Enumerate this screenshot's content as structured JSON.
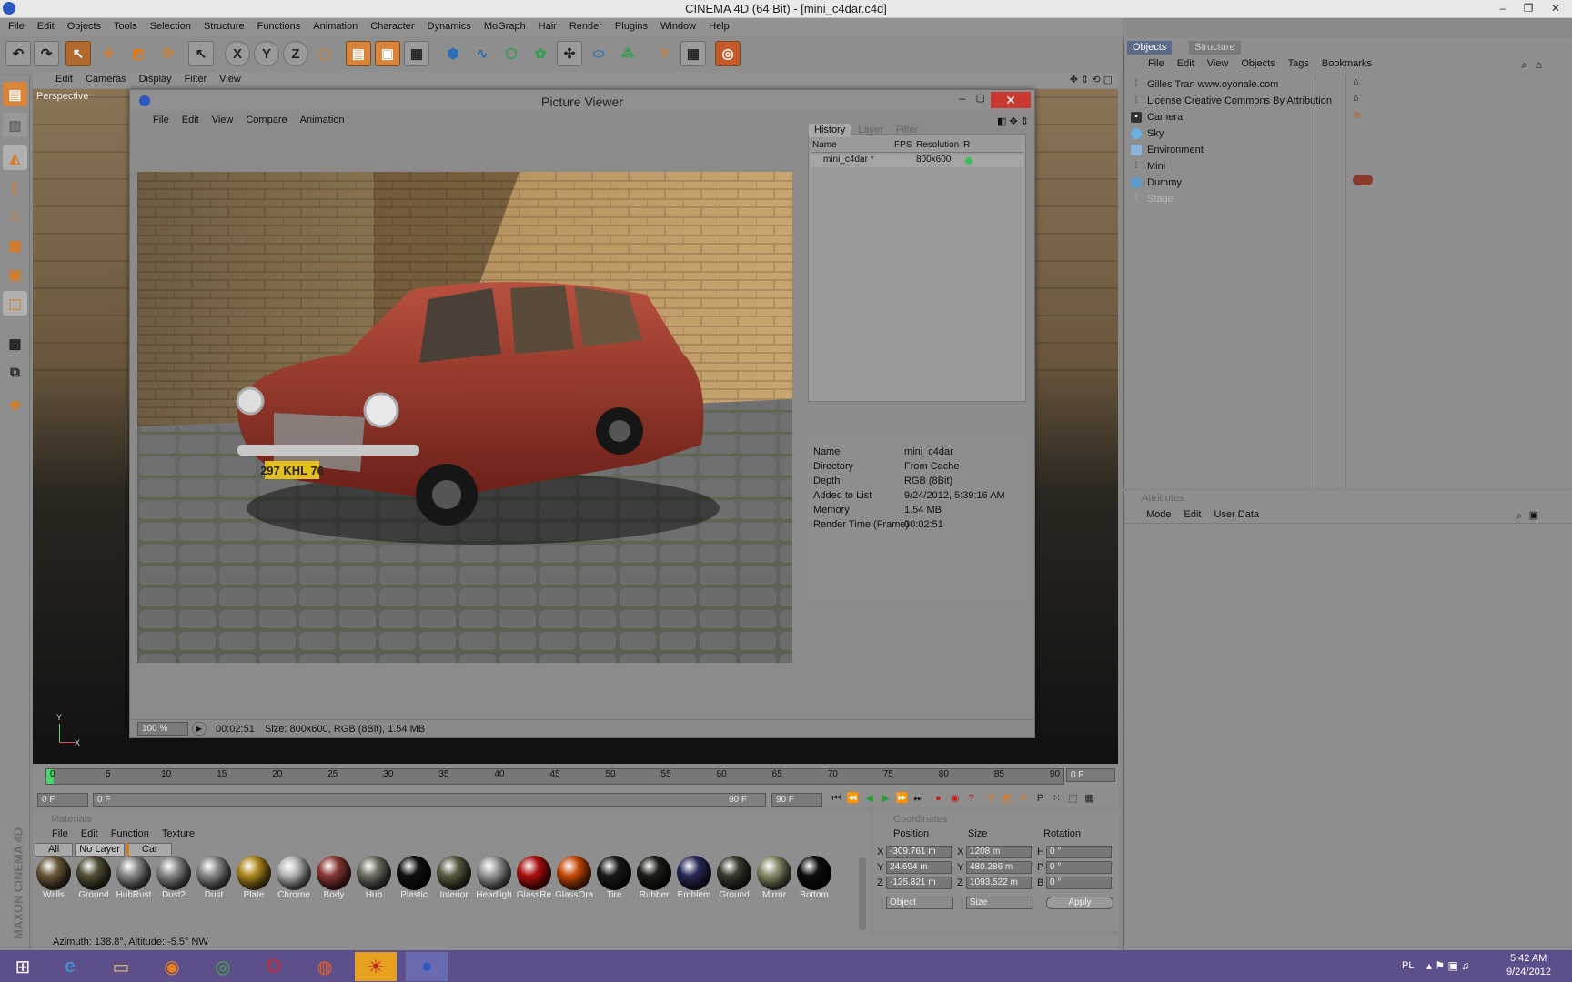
{
  "window": {
    "title": "CINEMA 4D (64 Bit) - [mini_c4dar.c4d]",
    "min": "–",
    "max": "❐",
    "close": "✕"
  },
  "menubar": [
    "File",
    "Edit",
    "Objects",
    "Tools",
    "Selection",
    "Structure",
    "Functions",
    "Animation",
    "Character",
    "Dynamics",
    "MoGraph",
    "Hair",
    "Render",
    "Plugins",
    "Window",
    "Help"
  ],
  "viewport": {
    "menu": [
      "Edit",
      "Cameras",
      "Display",
      "Filter",
      "View"
    ],
    "label": "Perspective",
    "axis_x": "X",
    "axis_y": "Y"
  },
  "picture_viewer": {
    "title": "Picture Viewer",
    "menu": [
      "File",
      "Edit",
      "View",
      "Compare",
      "Animation"
    ],
    "tabs": [
      "History",
      "Layer",
      "Filter"
    ],
    "history_headers": [
      "Name",
      "FPS",
      "Resolution",
      "R"
    ],
    "history_row": {
      "name": "mini_c4dar *",
      "fps": "",
      "resolution": "800x600"
    },
    "info": [
      {
        "label": "Name",
        "value": "mini_c4dar"
      },
      {
        "label": "Directory",
        "value": "From Cache"
      },
      {
        "label": "Depth",
        "value": "RGB (8Bit)"
      },
      {
        "label": "Added to List",
        "value": "9/24/2012, 5:39:16 AM"
      },
      {
        "label": "Memory",
        "value": "1.54 MB"
      },
      {
        "label": "Render Time (Frame)",
        "value": "00:02:51"
      }
    ],
    "zoom": "100 %",
    "time": "00:02:51",
    "status": "Size: 800x600, RGB (8Bit), 1.54 MB",
    "plate": "297 KHL 76"
  },
  "objects_panel": {
    "tabs": [
      "Objects",
      "Structure"
    ],
    "menu": [
      "File",
      "Edit",
      "View",
      "Objects",
      "Tags",
      "Bookmarks"
    ],
    "items": [
      "Gilles Tran www.oyonale.com",
      "License Creative Commons By Attribution",
      "Camera",
      "Sky",
      "Environment",
      "Mini",
      "Dummy",
      "Stage"
    ]
  },
  "attributes_panel": {
    "title": "Attributes",
    "menu": [
      "Mode",
      "Edit",
      "User Data"
    ]
  },
  "timeline": {
    "ticks": [
      "0",
      "5",
      "10",
      "15",
      "20",
      "25",
      "30",
      "35",
      "40",
      "45",
      "50",
      "55",
      "60",
      "65",
      "70",
      "75",
      "80",
      "85",
      "90"
    ],
    "current_frame": "0 F",
    "start": "0 F",
    "range_start": "0 F",
    "range_end": "90 F",
    "end": "90 F"
  },
  "materials": {
    "title": "Materials",
    "menu": [
      "File",
      "Edit",
      "Function",
      "Texture"
    ],
    "filters": [
      "All",
      "No Layer",
      "Car"
    ],
    "items": [
      {
        "name": "Walls",
        "color": "#6b5a3a"
      },
      {
        "name": "Ground",
        "color": "#555038"
      },
      {
        "name": "HubRust",
        "color": "#8a8a8a"
      },
      {
        "name": "Dust2",
        "color": "#8a8a8a"
      },
      {
        "name": "Dust",
        "color": "#8a8a8a"
      },
      {
        "name": "Plate",
        "color": "#b08a20"
      },
      {
        "name": "Chrome",
        "color": "#b8b8b8"
      },
      {
        "name": "Body",
        "color": "#8a3a35"
      },
      {
        "name": "Hub",
        "color": "#6e6e64"
      },
      {
        "name": "Plastic",
        "color": "#111111"
      },
      {
        "name": "Interior",
        "color": "#5e5a44"
      },
      {
        "name": "Headligh",
        "color": "#9a9a9a"
      },
      {
        "name": "GlassRe",
        "color": "#b01010"
      },
      {
        "name": "GlassOra",
        "color": "#c84a0a"
      },
      {
        "name": "Tire",
        "color": "#1a1a1a"
      },
      {
        "name": "Rubber",
        "color": "#1e1c16"
      },
      {
        "name": "Emblem",
        "color": "#2a2a5a"
      },
      {
        "name": "Ground",
        "color": "#3a3a30"
      },
      {
        "name": "Mirror",
        "color": "#8a8a6a"
      },
      {
        "name": "Bottom",
        "color": "#0e0e0e"
      }
    ]
  },
  "coordinates": {
    "title": "Coordinates",
    "headers": [
      "Position",
      "Size",
      "Rotation"
    ],
    "rows": [
      {
        "a": "X",
        "pos": "-309.761 m",
        "b": "X",
        "size": "1208 m",
        "c": "H",
        "rot": "0 °"
      },
      {
        "a": "Y",
        "pos": "24.694 m",
        "b": "Y",
        "size": "480.286 m",
        "c": "P",
        "rot": "0 °"
      },
      {
        "a": "Z",
        "pos": "-125.821 m",
        "b": "Z",
        "size": "1093.522 m",
        "c": "B",
        "rot": "0 °"
      }
    ],
    "mode": "Object",
    "size_mode": "Size",
    "apply": "Apply"
  },
  "statusline": "Azimuth: 138.8°, Altitude: -5.5° NW",
  "brand": "MAXON CINEMA 4D",
  "taskbar": {
    "lang": "PL",
    "time": "5:42 AM",
    "date": "9/24/2012"
  }
}
